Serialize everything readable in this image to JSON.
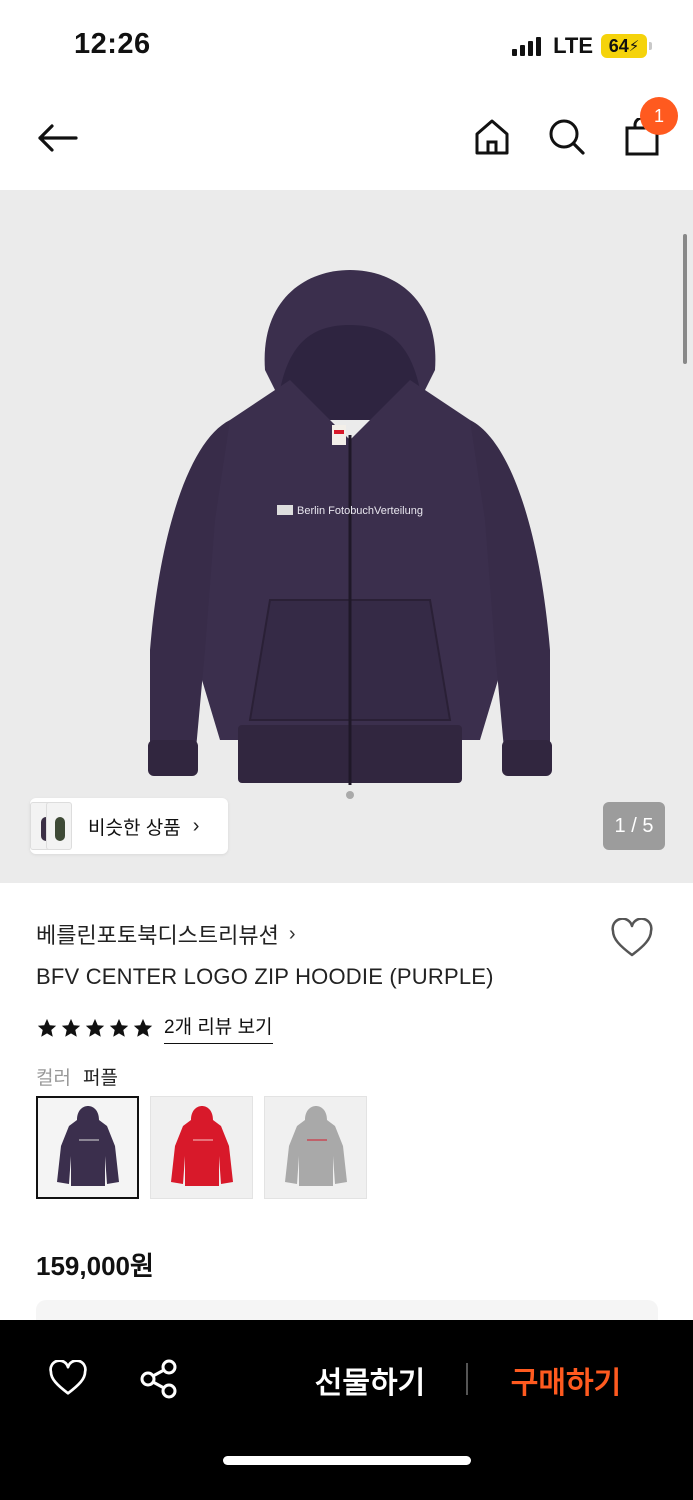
{
  "status": {
    "time": "12:26",
    "network": "LTE",
    "battery": "64"
  },
  "nav": {
    "cart_count": "1"
  },
  "hero": {
    "similar_label": "비슷한 상품",
    "page_indicator": "1 / 5",
    "logo_text": "Berlin FotobuchVerteilung"
  },
  "product": {
    "brand": "베를린포토북디스트리뷰션",
    "title": "BFV CENTER LOGO ZIP HOODIE (PURPLE)",
    "review_link": "2개 리뷰 보기",
    "rating": 5,
    "color_label": "컬러",
    "color_value": "퍼플",
    "swatches": [
      {
        "name": "purple",
        "color": "#3b2f4d"
      },
      {
        "name": "red",
        "color": "#d8192a"
      },
      {
        "name": "gray",
        "color": "#a9a9a9"
      }
    ],
    "price": "159,000원"
  },
  "bottom_bar": {
    "gift_label": "선물하기",
    "buy_label": "구매하기"
  },
  "colors": {
    "accent": "#ff5a1f",
    "hero_bg": "#ebebeb",
    "hoodie": "#3b2f4d"
  }
}
